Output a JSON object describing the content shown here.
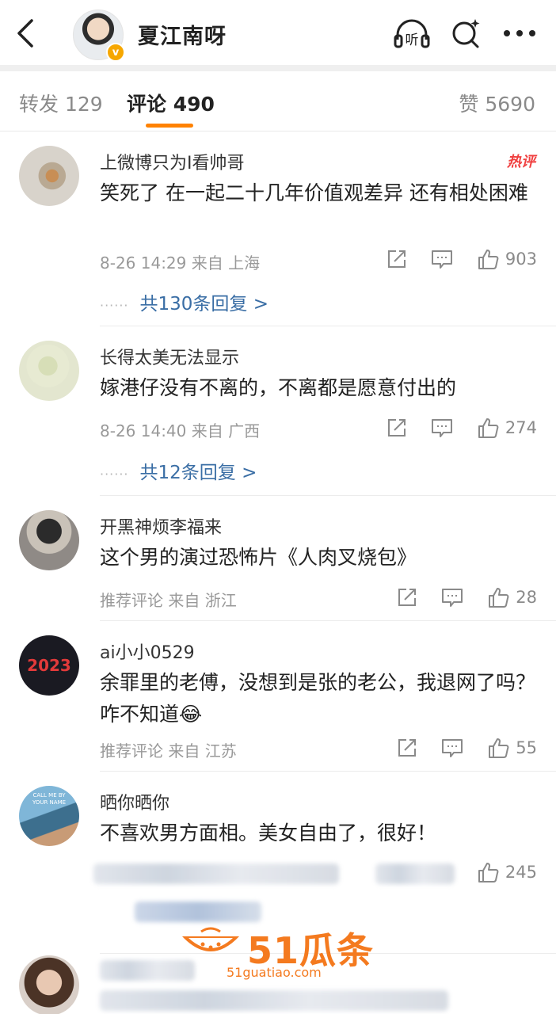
{
  "header": {
    "title": "夏江南呀",
    "back_icon": "back-arrow-icon",
    "listen_label": "听",
    "badge": "v"
  },
  "tabs": [
    {
      "label": "转发 129"
    },
    {
      "label": "评论 490",
      "active": true
    },
    {
      "label": "赞 5690"
    }
  ],
  "comments": [
    {
      "name": "上微博只为I看帅哥",
      "text": "笑死了 在一起二十几年价值观差异 还有相处困难",
      "meta": "8-26 14:29  来自 上海",
      "likes": "903",
      "badge": "热评",
      "replies": "共130条回复 >"
    },
    {
      "name": "长得太美无法显示",
      "text": "嫁港仔没有不离的，不离都是愿意付出的",
      "meta": "8-26 14:40  来自 广西",
      "likes": "274",
      "replies": "共12条回复 >"
    },
    {
      "name": "开黑神烦李福来",
      "text": "这个男的演过恐怖片《人肉叉烧包》",
      "meta": "推荐评论  来自 浙江",
      "likes": "28"
    },
    {
      "name": "ai小小0529",
      "text": "余罪里的老傅，没想到是张的老公，我退网了吗？咋不知道😂",
      "meta": "推荐评论  来自 江苏",
      "likes": "55"
    },
    {
      "name": "晒你晒你",
      "text": "不喜欢男方面相。美女自由了，很好！",
      "likes": "245"
    }
  ],
  "avatar_text": {
    "c4": "2023",
    "c5": "CALL ME BY YOUR NAME"
  },
  "watermark": {
    "brand": "51瓜条",
    "url": "51guatiao.com"
  },
  "colors": {
    "accent": "#ff8200",
    "link": "#3a6ea5",
    "hot": "#f04040",
    "watermark": "#f47a1f"
  }
}
